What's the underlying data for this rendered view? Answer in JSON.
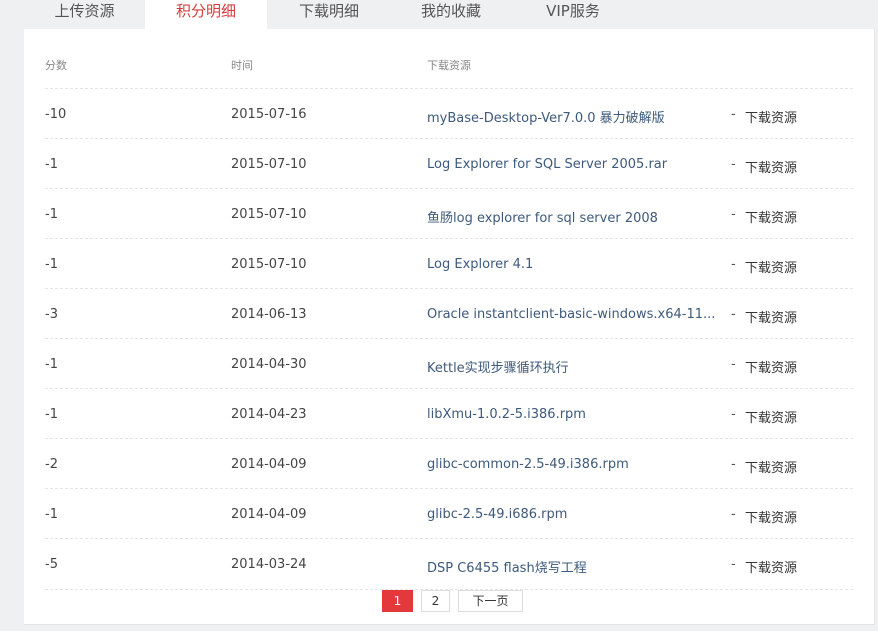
{
  "tabs": [
    {
      "label": "上传资源"
    },
    {
      "label": "积分明细"
    },
    {
      "label": "下载明细"
    },
    {
      "label": "我的收藏"
    },
    {
      "label": "VIP服务"
    }
  ],
  "active_tab_index": 1,
  "table": {
    "headers": {
      "score": "分数",
      "time": "时间",
      "resource": "下载资源"
    },
    "rows": [
      {
        "score": "-10",
        "time": "2015-07-16",
        "name": "myBase-Desktop-Ver7.0.0 暴力破解版",
        "sep": "-",
        "link": "下载资源"
      },
      {
        "score": "-1",
        "time": "2015-07-10",
        "name": "Log Explorer for SQL Server 2005.rar",
        "sep": "-",
        "link": "下载资源"
      },
      {
        "score": "-1",
        "time": "2015-07-10",
        "name": "鱼肠log explorer for sql server 2008",
        "sep": "-",
        "link": "下载资源"
      },
      {
        "score": "-1",
        "time": "2015-07-10",
        "name": "Log Explorer 4.1",
        "sep": "-",
        "link": "下载资源"
      },
      {
        "score": "-3",
        "time": "2014-06-13",
        "name": "Oracle instantclient-basic-windows.x64-11...",
        "sep": "-",
        "link": "下载资源"
      },
      {
        "score": "-1",
        "time": "2014-04-30",
        "name": "Kettle实现步骤循环执行",
        "sep": "-",
        "link": "下载资源"
      },
      {
        "score": "-1",
        "time": "2014-04-23",
        "name": "libXmu-1.0.2-5.i386.rpm",
        "sep": "-",
        "link": "下载资源"
      },
      {
        "score": "-2",
        "time": "2014-04-09",
        "name": "glibc-common-2.5-49.i386.rpm",
        "sep": "-",
        "link": "下载资源"
      },
      {
        "score": "-1",
        "time": "2014-04-09",
        "name": "glibc-2.5-49.i686.rpm",
        "sep": "-",
        "link": "下载资源"
      },
      {
        "score": "-5",
        "time": "2014-03-24",
        "name": "DSP C6455 flash烧写工程",
        "sep": "-",
        "link": "下载资源"
      }
    ]
  },
  "pagination": {
    "pages": [
      "1",
      "2"
    ],
    "current_page": 1,
    "next_label": "下一页"
  },
  "colors": {
    "active_tab_text": "#d43c3c",
    "active_page_bg": "#e4393c",
    "resource_link": "#3d5a7c"
  }
}
